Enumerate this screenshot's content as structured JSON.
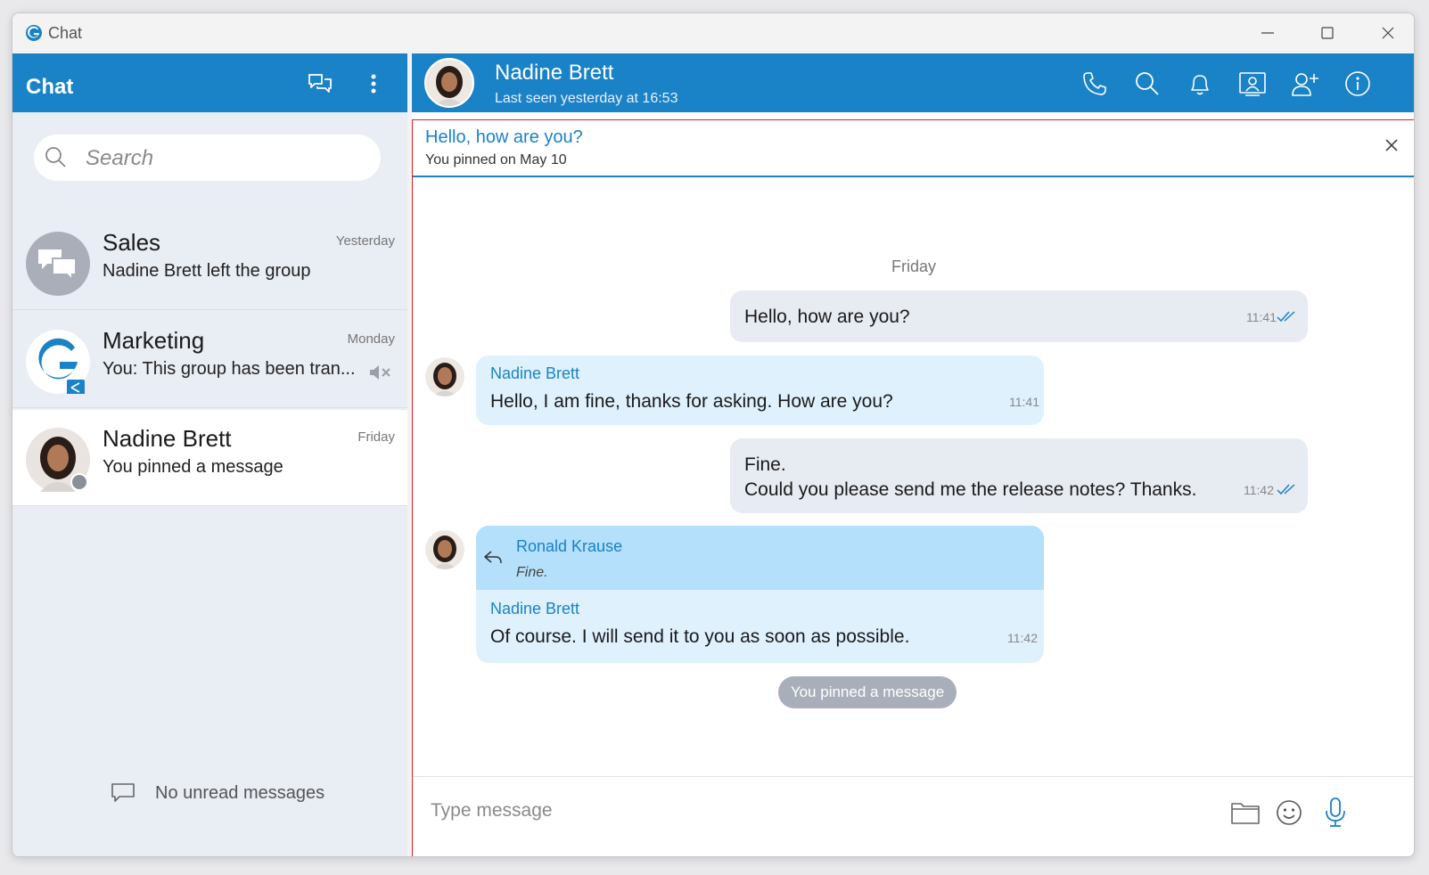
{
  "window": {
    "title": "Chat"
  },
  "sidebar": {
    "title": "Chat",
    "search_placeholder": "Search",
    "conversations": [
      {
        "name": "Sales",
        "time": "Yesterday",
        "preview": "Nadine Brett left the group",
        "avatar": "group-chat-icon"
      },
      {
        "name": "Marketing",
        "time": "Monday",
        "preview": "You: This group has been tran...",
        "avatar": "brand-logo",
        "muted": true
      },
      {
        "name": "Nadine Brett",
        "time": "Friday",
        "preview": "You pinned a message",
        "avatar": "user-photo",
        "status": "offline"
      }
    ],
    "footer": "No unread messages"
  },
  "chat": {
    "name": "Nadine Brett",
    "status": "Last seen yesterday at 16:53",
    "pinned": {
      "text": "Hello, how are you?",
      "sub": "You pinned on May 10"
    },
    "day_label": "Friday",
    "messages": [
      {
        "text": "Hello, how are you?",
        "time": "11:41",
        "direction": "out"
      },
      {
        "sender": "Nadine Brett",
        "text": "Hello, I am fine, thanks for asking. How are you?",
        "time": "11:41",
        "direction": "in"
      },
      {
        "line1": "Fine.",
        "line2": "Could you please send me the release notes? Thanks.",
        "time": "11:42",
        "direction": "out"
      },
      {
        "reply_sender": "Ronald Krause",
        "reply_text": "Fine.",
        "sender": "Nadine Brett",
        "text": "Of course. I will send it to you as soon as possible.",
        "time": "11:42",
        "direction": "in"
      }
    ],
    "system_message": "You pinned a message",
    "composer_placeholder": "Type message"
  },
  "colors": {
    "accent": "#1a82c7",
    "pinned_frame": "#d81f26",
    "bubble_out": "#e7ebf2",
    "bubble_in": "#dff1fd",
    "reply_bg": "#b4e0fb"
  }
}
